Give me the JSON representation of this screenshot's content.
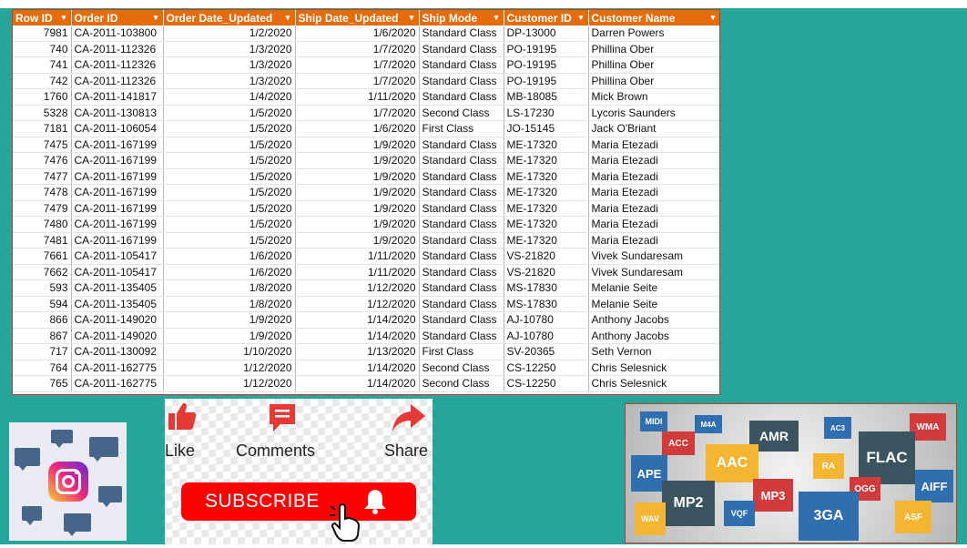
{
  "table": {
    "columns": [
      "Row ID",
      "Order ID",
      "Order Date_Updated",
      "Ship Date_Updated",
      "Ship Mode",
      "Customer ID",
      "Customer Name"
    ],
    "rows": [
      [
        "7981",
        "CA-2011-103800",
        "1/2/2020",
        "1/6/2020",
        "Standard Class",
        "DP-13000",
        "Darren Powers"
      ],
      [
        "740",
        "CA-2011-112326",
        "1/3/2020",
        "1/7/2020",
        "Standard Class",
        "PO-19195",
        "Phillina Ober"
      ],
      [
        "741",
        "CA-2011-112326",
        "1/3/2020",
        "1/7/2020",
        "Standard Class",
        "PO-19195",
        "Phillina Ober"
      ],
      [
        "742",
        "CA-2011-112326",
        "1/3/2020",
        "1/7/2020",
        "Standard Class",
        "PO-19195",
        "Phillina Ober"
      ],
      [
        "1760",
        "CA-2011-141817",
        "1/4/2020",
        "1/11/2020",
        "Standard Class",
        "MB-18085",
        "Mick Brown"
      ],
      [
        "5328",
        "CA-2011-130813",
        "1/5/2020",
        "1/7/2020",
        "Second Class",
        "LS-17230",
        "Lycoris Saunders"
      ],
      [
        "7181",
        "CA-2011-106054",
        "1/5/2020",
        "1/6/2020",
        "First Class",
        "JO-15145",
        "Jack O'Briant"
      ],
      [
        "7475",
        "CA-2011-167199",
        "1/5/2020",
        "1/9/2020",
        "Standard Class",
        "ME-17320",
        "Maria Etezadi"
      ],
      [
        "7476",
        "CA-2011-167199",
        "1/5/2020",
        "1/9/2020",
        "Standard Class",
        "ME-17320",
        "Maria Etezadi"
      ],
      [
        "7477",
        "CA-2011-167199",
        "1/5/2020",
        "1/9/2020",
        "Standard Class",
        "ME-17320",
        "Maria Etezadi"
      ],
      [
        "7478",
        "CA-2011-167199",
        "1/5/2020",
        "1/9/2020",
        "Standard Class",
        "ME-17320",
        "Maria Etezadi"
      ],
      [
        "7479",
        "CA-2011-167199",
        "1/5/2020",
        "1/9/2020",
        "Standard Class",
        "ME-17320",
        "Maria Etezadi"
      ],
      [
        "7480",
        "CA-2011-167199",
        "1/5/2020",
        "1/9/2020",
        "Standard Class",
        "ME-17320",
        "Maria Etezadi"
      ],
      [
        "7481",
        "CA-2011-167199",
        "1/5/2020",
        "1/9/2020",
        "Standard Class",
        "ME-17320",
        "Maria Etezadi"
      ],
      [
        "7661",
        "CA-2011-105417",
        "1/6/2020",
        "1/11/2020",
        "Standard Class",
        "VS-21820",
        "Vivek Sundaresam"
      ],
      [
        "7662",
        "CA-2011-105417",
        "1/6/2020",
        "1/11/2020",
        "Standard Class",
        "VS-21820",
        "Vivek Sundaresam"
      ],
      [
        "593",
        "CA-2011-135405",
        "1/8/2020",
        "1/12/2020",
        "Standard Class",
        "MS-17830",
        "Melanie Seite"
      ],
      [
        "594",
        "CA-2011-135405",
        "1/8/2020",
        "1/12/2020",
        "Standard Class",
        "MS-17830",
        "Melanie Seite"
      ],
      [
        "866",
        "CA-2011-149020",
        "1/9/2020",
        "1/14/2020",
        "Standard Class",
        "AJ-10780",
        "Anthony Jacobs"
      ],
      [
        "867",
        "CA-2011-149020",
        "1/9/2020",
        "1/14/2020",
        "Standard Class",
        "AJ-10780",
        "Anthony Jacobs"
      ],
      [
        "717",
        "CA-2011-130092",
        "1/10/2020",
        "1/13/2020",
        "First Class",
        "SV-20365",
        "Seth Vernon"
      ],
      [
        "764",
        "CA-2011-162775",
        "1/12/2020",
        "1/14/2020",
        "Second Class",
        "CS-12250",
        "Chris Selesnick"
      ],
      [
        "765",
        "CA-2011-162775",
        "1/12/2020",
        "1/14/2020",
        "Second Class",
        "CS-12250",
        "Chris Selesnick"
      ]
    ],
    "numeric_columns": [
      0,
      2,
      3
    ],
    "header_color": "#e46c0a"
  },
  "social": {
    "like_label": "Like",
    "comments_label": "Comments",
    "share_label": "Share",
    "subscribe_label": "SUBSCRIBE",
    "accent_color": "#ff0000"
  },
  "instagram": {
    "icon": "instagram-icon"
  },
  "formats": {
    "labels": [
      "MIDI",
      "M4A",
      "AMR",
      "AC3",
      "WMA",
      "ACC",
      "AAC",
      "FLAC",
      "APE",
      "RA",
      "AIFF",
      "MP3",
      "OGG",
      "MP2",
      "VQF",
      "3GA",
      "WAV",
      "ASF"
    ]
  }
}
